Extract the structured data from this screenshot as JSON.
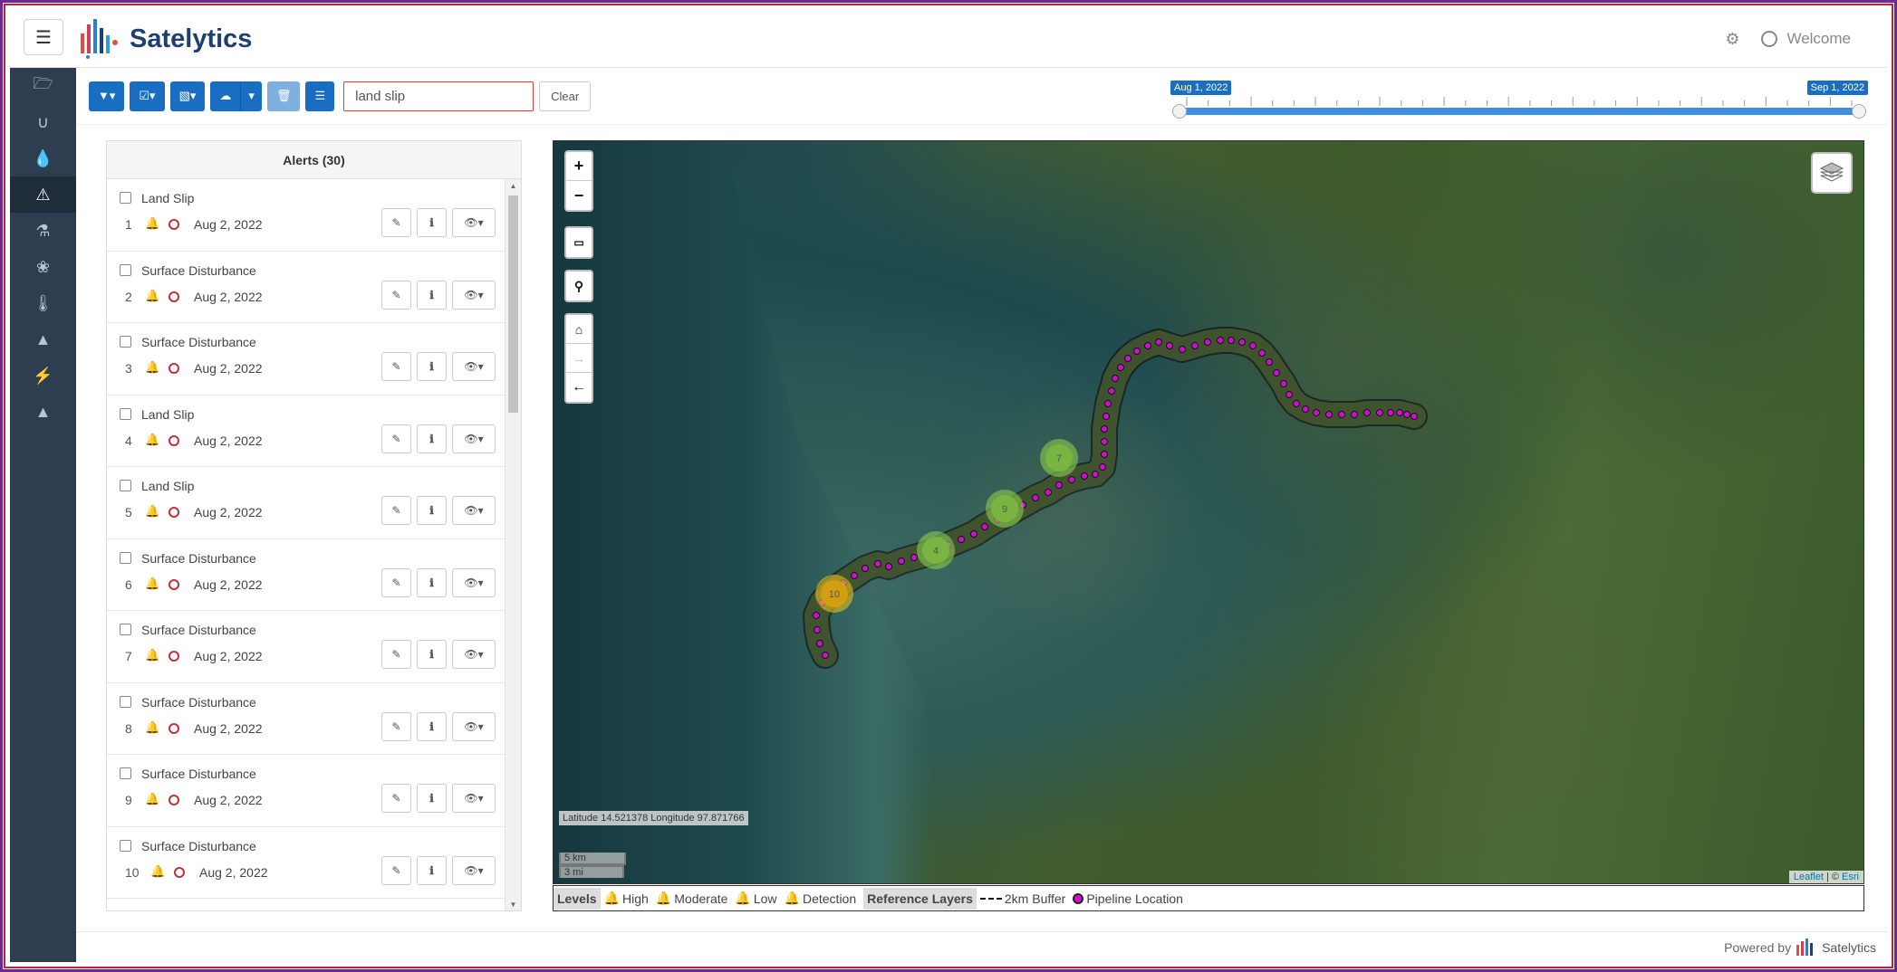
{
  "app": {
    "brand": "Satelytics",
    "welcome": "Welcome"
  },
  "sidebar": {
    "items": [
      {
        "icon": "folder-open-icon"
      },
      {
        "icon": "magnet-icon"
      },
      {
        "icon": "droplet-icon"
      },
      {
        "icon": "warning-icon",
        "active": true
      },
      {
        "icon": "lab-bottle-icon"
      },
      {
        "icon": "leaf-icon"
      },
      {
        "icon": "thermometer-icon"
      },
      {
        "icon": "tree-icon"
      },
      {
        "icon": "lightning-icon"
      },
      {
        "icon": "area-chart-icon"
      }
    ]
  },
  "toolbar": {
    "search_value": "land slip",
    "clear_label": "Clear"
  },
  "timeline": {
    "start_label": "Aug 1, 2022",
    "end_label": "Sep 1, 2022"
  },
  "alerts": {
    "header": "Alerts (30)",
    "rows": [
      {
        "num": "1",
        "title": "Land Slip",
        "level": "high",
        "date": "Aug 2, 2022"
      },
      {
        "num": "2",
        "title": "Surface Disturbance",
        "level": "detection",
        "date": "Aug 2, 2022"
      },
      {
        "num": "3",
        "title": "Surface Disturbance",
        "level": "detection",
        "date": "Aug 2, 2022"
      },
      {
        "num": "4",
        "title": "Land Slip",
        "level": "high",
        "date": "Aug 2, 2022"
      },
      {
        "num": "5",
        "title": "Land Slip",
        "level": "high",
        "date": "Aug 2, 2022"
      },
      {
        "num": "6",
        "title": "Surface Disturbance",
        "level": "detection",
        "date": "Aug 2, 2022"
      },
      {
        "num": "7",
        "title": "Surface Disturbance",
        "level": "detection",
        "date": "Aug 2, 2022"
      },
      {
        "num": "8",
        "title": "Surface Disturbance",
        "level": "detection",
        "date": "Aug 2, 2022"
      },
      {
        "num": "9",
        "title": "Surface Disturbance",
        "level": "detection",
        "date": "Aug 2, 2022"
      },
      {
        "num": "10",
        "title": "Surface Disturbance",
        "level": "detection",
        "date": "Aug 2, 2022"
      }
    ]
  },
  "map": {
    "coords_text": "Latitude 14.521378 Longitude 97.871766",
    "scale_km": "5 km",
    "scale_mi": "3 mi",
    "attribution_link": "Leaflet",
    "attribution_sep": " | © ",
    "attribution_esri": "Esri",
    "clusters": [
      "10",
      "4",
      "9",
      "7"
    ]
  },
  "legend": {
    "levels_title": "Levels",
    "high": "High",
    "moderate": "Moderate",
    "low": "Low",
    "detection": "Detection",
    "ref_title": "Reference Layers",
    "buffer": "2km Buffer",
    "pipeline": "Pipeline Location"
  },
  "footer": {
    "powered_by": "Powered by",
    "brand": "Satelytics"
  },
  "colors": {
    "accent": "#1a6ec2",
    "high": "#c0303a",
    "moderate": "#f0a020",
    "low": "#2a8fe0",
    "detection": "#111111",
    "pipeline": "#d010d0",
    "sidebar": "#2c3e50"
  }
}
